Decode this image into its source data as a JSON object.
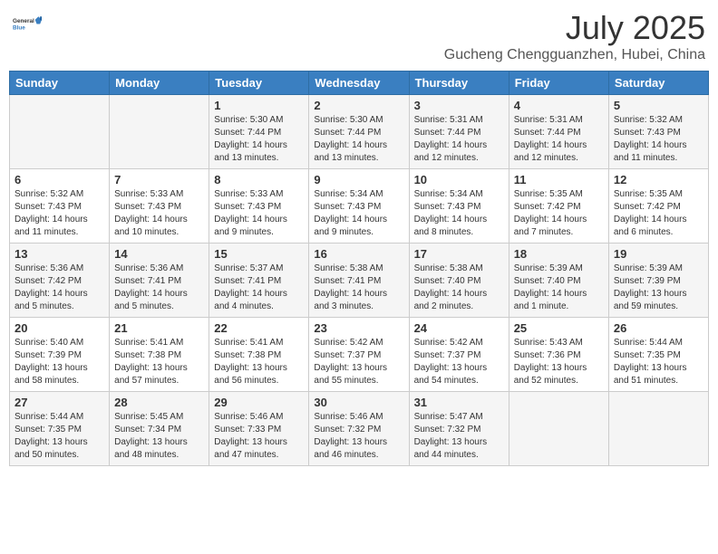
{
  "header": {
    "logo_general": "General",
    "logo_blue": "Blue",
    "month_year": "July 2025",
    "location": "Gucheng Chengguanzhen, Hubei, China"
  },
  "weekdays": [
    "Sunday",
    "Monday",
    "Tuesday",
    "Wednesday",
    "Thursday",
    "Friday",
    "Saturday"
  ],
  "weeks": [
    [
      {
        "day": "",
        "info": ""
      },
      {
        "day": "",
        "info": ""
      },
      {
        "day": "1",
        "info": "Sunrise: 5:30 AM\nSunset: 7:44 PM\nDaylight: 14 hours and 13 minutes."
      },
      {
        "day": "2",
        "info": "Sunrise: 5:30 AM\nSunset: 7:44 PM\nDaylight: 14 hours and 13 minutes."
      },
      {
        "day": "3",
        "info": "Sunrise: 5:31 AM\nSunset: 7:44 PM\nDaylight: 14 hours and 12 minutes."
      },
      {
        "day": "4",
        "info": "Sunrise: 5:31 AM\nSunset: 7:44 PM\nDaylight: 14 hours and 12 minutes."
      },
      {
        "day": "5",
        "info": "Sunrise: 5:32 AM\nSunset: 7:43 PM\nDaylight: 14 hours and 11 minutes."
      }
    ],
    [
      {
        "day": "6",
        "info": "Sunrise: 5:32 AM\nSunset: 7:43 PM\nDaylight: 14 hours and 11 minutes."
      },
      {
        "day": "7",
        "info": "Sunrise: 5:33 AM\nSunset: 7:43 PM\nDaylight: 14 hours and 10 minutes."
      },
      {
        "day": "8",
        "info": "Sunrise: 5:33 AM\nSunset: 7:43 PM\nDaylight: 14 hours and 9 minutes."
      },
      {
        "day": "9",
        "info": "Sunrise: 5:34 AM\nSunset: 7:43 PM\nDaylight: 14 hours and 9 minutes."
      },
      {
        "day": "10",
        "info": "Sunrise: 5:34 AM\nSunset: 7:43 PM\nDaylight: 14 hours and 8 minutes."
      },
      {
        "day": "11",
        "info": "Sunrise: 5:35 AM\nSunset: 7:42 PM\nDaylight: 14 hours and 7 minutes."
      },
      {
        "day": "12",
        "info": "Sunrise: 5:35 AM\nSunset: 7:42 PM\nDaylight: 14 hours and 6 minutes."
      }
    ],
    [
      {
        "day": "13",
        "info": "Sunrise: 5:36 AM\nSunset: 7:42 PM\nDaylight: 14 hours and 5 minutes."
      },
      {
        "day": "14",
        "info": "Sunrise: 5:36 AM\nSunset: 7:41 PM\nDaylight: 14 hours and 5 minutes."
      },
      {
        "day": "15",
        "info": "Sunrise: 5:37 AM\nSunset: 7:41 PM\nDaylight: 14 hours and 4 minutes."
      },
      {
        "day": "16",
        "info": "Sunrise: 5:38 AM\nSunset: 7:41 PM\nDaylight: 14 hours and 3 minutes."
      },
      {
        "day": "17",
        "info": "Sunrise: 5:38 AM\nSunset: 7:40 PM\nDaylight: 14 hours and 2 minutes."
      },
      {
        "day": "18",
        "info": "Sunrise: 5:39 AM\nSunset: 7:40 PM\nDaylight: 14 hours and 1 minute."
      },
      {
        "day": "19",
        "info": "Sunrise: 5:39 AM\nSunset: 7:39 PM\nDaylight: 13 hours and 59 minutes."
      }
    ],
    [
      {
        "day": "20",
        "info": "Sunrise: 5:40 AM\nSunset: 7:39 PM\nDaylight: 13 hours and 58 minutes."
      },
      {
        "day": "21",
        "info": "Sunrise: 5:41 AM\nSunset: 7:38 PM\nDaylight: 13 hours and 57 minutes."
      },
      {
        "day": "22",
        "info": "Sunrise: 5:41 AM\nSunset: 7:38 PM\nDaylight: 13 hours and 56 minutes."
      },
      {
        "day": "23",
        "info": "Sunrise: 5:42 AM\nSunset: 7:37 PM\nDaylight: 13 hours and 55 minutes."
      },
      {
        "day": "24",
        "info": "Sunrise: 5:42 AM\nSunset: 7:37 PM\nDaylight: 13 hours and 54 minutes."
      },
      {
        "day": "25",
        "info": "Sunrise: 5:43 AM\nSunset: 7:36 PM\nDaylight: 13 hours and 52 minutes."
      },
      {
        "day": "26",
        "info": "Sunrise: 5:44 AM\nSunset: 7:35 PM\nDaylight: 13 hours and 51 minutes."
      }
    ],
    [
      {
        "day": "27",
        "info": "Sunrise: 5:44 AM\nSunset: 7:35 PM\nDaylight: 13 hours and 50 minutes."
      },
      {
        "day": "28",
        "info": "Sunrise: 5:45 AM\nSunset: 7:34 PM\nDaylight: 13 hours and 48 minutes."
      },
      {
        "day": "29",
        "info": "Sunrise: 5:46 AM\nSunset: 7:33 PM\nDaylight: 13 hours and 47 minutes."
      },
      {
        "day": "30",
        "info": "Sunrise: 5:46 AM\nSunset: 7:32 PM\nDaylight: 13 hours and 46 minutes."
      },
      {
        "day": "31",
        "info": "Sunrise: 5:47 AM\nSunset: 7:32 PM\nDaylight: 13 hours and 44 minutes."
      },
      {
        "day": "",
        "info": ""
      },
      {
        "day": "",
        "info": ""
      }
    ]
  ]
}
